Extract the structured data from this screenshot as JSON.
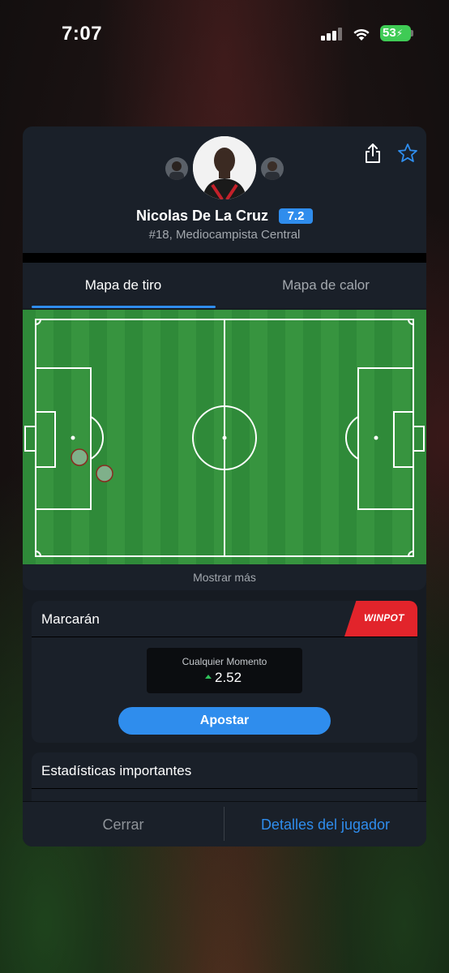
{
  "status_bar": {
    "time": "7:07",
    "battery": "53"
  },
  "player": {
    "name": "Nicolas De La Cruz",
    "rating": "7.2",
    "subtitle": "#18, Mediocampista Central"
  },
  "tabs": [
    {
      "label": "Mapa de tiro",
      "active": true
    },
    {
      "label": "Mapa de calor",
      "active": false
    }
  ],
  "shot_map": {
    "show_more_label": "Mostrar más",
    "shots": [
      {
        "marker": "shot"
      },
      {
        "marker": "shot"
      }
    ]
  },
  "market": {
    "title": "Marcarán",
    "sponsor": "WINPOT",
    "odds_label": "Cualquier Momento",
    "odds_value": "2.52",
    "odds_trend": "up",
    "bet_label": "Apostar"
  },
  "stats": {
    "title": "Estadísticas importantes"
  },
  "footer": {
    "close_label": "Cerrar",
    "details_label": "Detalles del jugador"
  },
  "colors": {
    "accent": "#2f8ded",
    "pitch": "#2e8b3a",
    "sponsor_red": "#e2242b",
    "trend_up": "#2fc15a",
    "shot_fill": "#7fb08a",
    "shot_stroke": "#8a2b20"
  }
}
